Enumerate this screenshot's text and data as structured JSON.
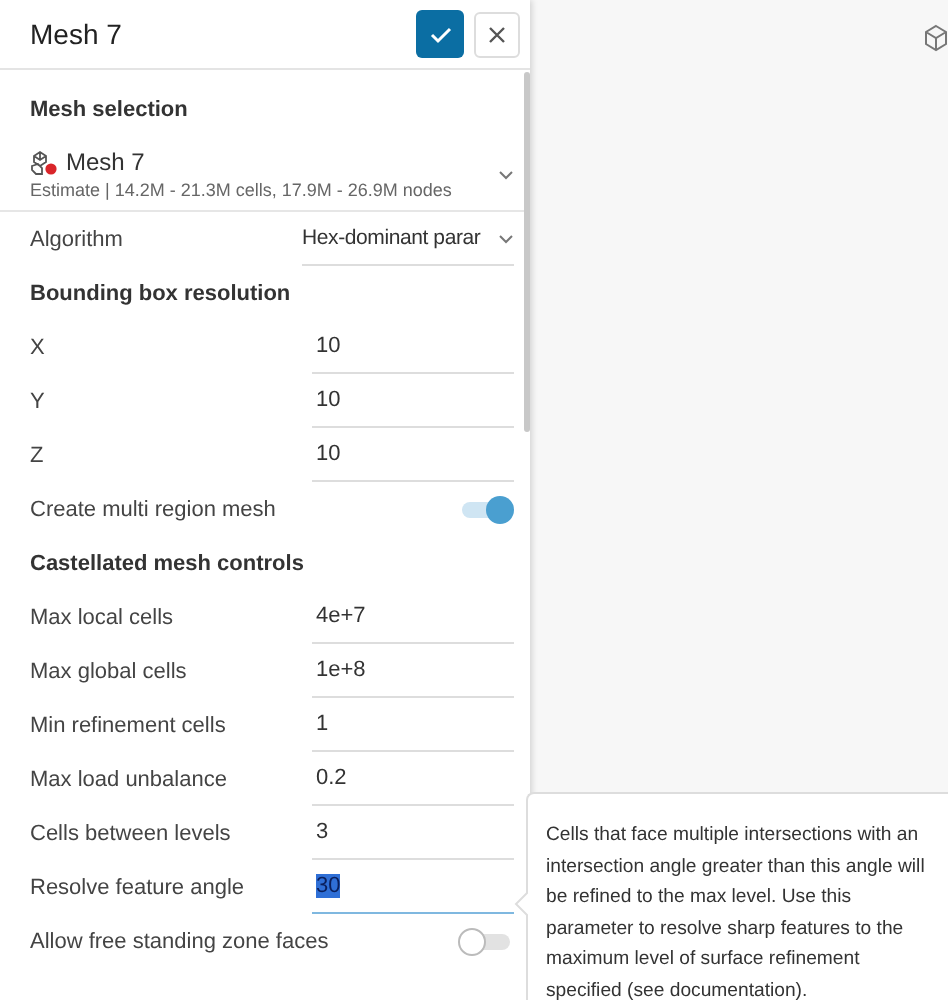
{
  "panel": {
    "title": "Mesh 7"
  },
  "mesh_selection": {
    "heading": "Mesh selection",
    "name": "Mesh 7",
    "estimate": "Estimate | 14.2M - 21.3M cells, 17.9M - 26.9M nodes"
  },
  "rows": [
    {
      "kind": "select",
      "label": "Algorithm",
      "value": "Hex-dominant parar"
    },
    {
      "kind": "heading",
      "label": "Bounding box resolution"
    },
    {
      "kind": "field",
      "label": "X",
      "value": "10",
      "focused": false
    },
    {
      "kind": "field",
      "label": "Y",
      "value": "10",
      "focused": false
    },
    {
      "kind": "field",
      "label": "Z",
      "value": "10",
      "focused": false
    },
    {
      "kind": "toggle",
      "label": "Create multi region mesh",
      "on": true
    },
    {
      "kind": "heading",
      "label": "Castellated mesh controls"
    },
    {
      "kind": "field",
      "label": "Max local cells",
      "value": "4e+7",
      "focused": false
    },
    {
      "kind": "field",
      "label": "Max global cells",
      "value": "1e+8",
      "focused": false
    },
    {
      "kind": "field",
      "label": "Min refinement cells",
      "value": "1",
      "focused": false
    },
    {
      "kind": "field",
      "label": "Max load unbalance",
      "value": "0.2",
      "focused": false
    },
    {
      "kind": "field",
      "label": "Cells between levels",
      "value": "3",
      "focused": false
    },
    {
      "kind": "field",
      "label": "Resolve feature angle",
      "value": "30",
      "focused": true
    },
    {
      "kind": "toggle",
      "label": "Allow free standing zone faces",
      "on": false
    }
  ],
  "tooltip": {
    "text": "Cells that face multiple intersections with an intersection angle greater than this angle will be refined to the max level. Use this parameter to resolve sharp features to the maximum level of surface refinement specified (see documentation)."
  }
}
